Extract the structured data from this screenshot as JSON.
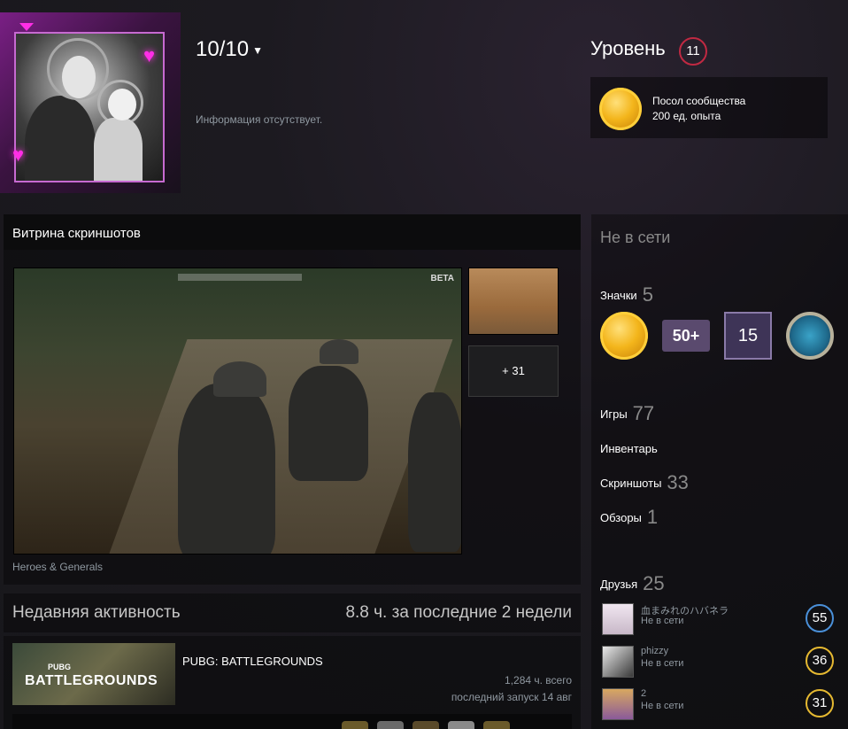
{
  "profile": {
    "persona_name": "10/10",
    "summary": "Информация отсутствует."
  },
  "level": {
    "label": "Уровень",
    "value": "11",
    "color": "#c02942"
  },
  "favorite_badge": {
    "name": "Посол сообщества",
    "xp": "200 ед. опыта",
    "icon": "community-ambassador-coin-icon"
  },
  "screenshot_showcase": {
    "title": "Витрина скриншотов",
    "more_label": "+ 31",
    "caption": "Heroes & Generals",
    "main_overlay_text": "BETA"
  },
  "recent_activity": {
    "label": "Недавняя активность",
    "hours_summary": "8.8 ч. за последние 2 недели"
  },
  "recent_game": {
    "name": "PUBG: BATTLEGROUNDS",
    "capsule_text": "BATTLEGROUNDS",
    "capsule_small": "PUBG",
    "total": "1,284 ч. всего",
    "last_played": "последний запуск 14 авг"
  },
  "sidebar": {
    "status": "Не в сети",
    "badges": {
      "label": "Значки",
      "count": "5",
      "b50_text": "50+",
      "b15_text": "15"
    },
    "games": {
      "label": "Игры",
      "count": "77"
    },
    "inventory": {
      "label": "Инвентарь"
    },
    "screenshots": {
      "label": "Скриншоты",
      "count": "33"
    },
    "reviews": {
      "label": "Обзоры",
      "count": "1"
    },
    "friends": {
      "label": "Друзья",
      "count": "25"
    }
  },
  "friends": [
    {
      "name": "血まみれのハバネラ",
      "status": "Не в сети",
      "level": "55",
      "level_color": "#4a90d9"
    },
    {
      "name": "phizzy",
      "status": "Не в сети",
      "level": "36",
      "level_color": "#e6b931"
    },
    {
      "name": "2",
      "status": "Не в сети",
      "level": "31",
      "level_color": "#e6b931"
    }
  ]
}
